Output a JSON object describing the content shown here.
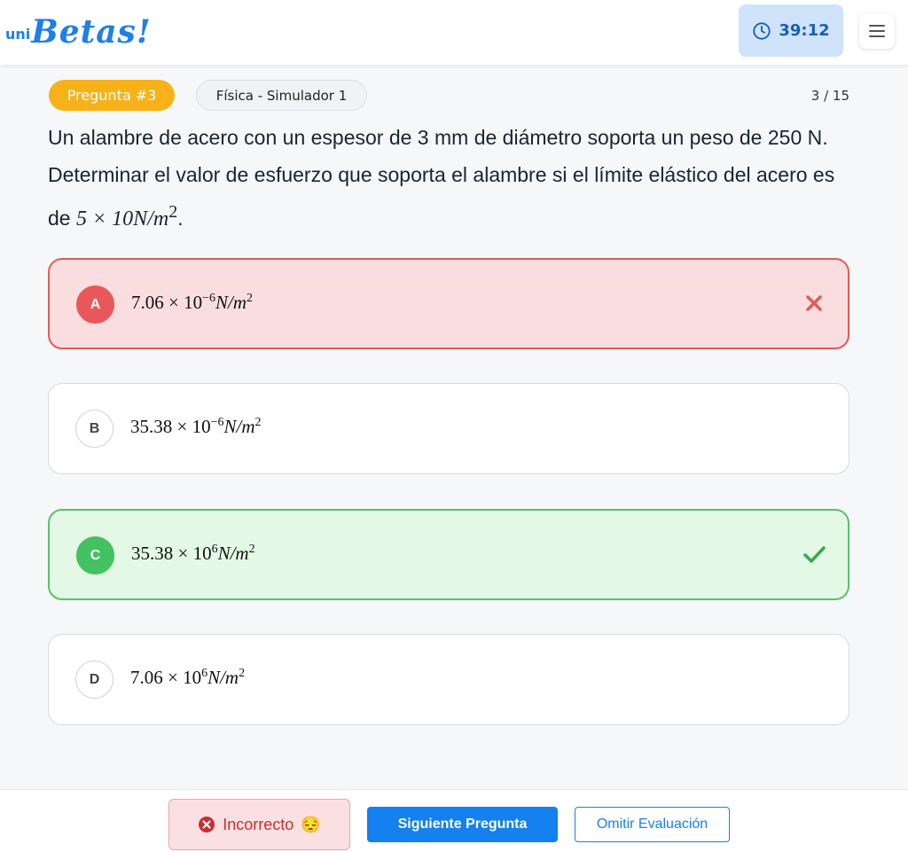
{
  "header": {
    "logo_prefix": "uni",
    "logo_main": "Betas!",
    "timer": "39:12",
    "colors": {
      "brand": "#1e7fe6",
      "timer_bg": "#cfe3fb"
    }
  },
  "question": {
    "badge": "Pregunta #3",
    "subject": "Física - Simulador 1",
    "counter": "3 / 15",
    "text_part1": "Un alambre de acero con un espesor de 3 mm de diámetro soporta un peso de 250 N. Determinar el valor de esfuerzo que soporta el alambre si el límite elástico del acero es de ",
    "formula_main": "5 × 10N/m",
    "formula_exp": "2",
    "text_end": "."
  },
  "options": [
    {
      "letter": "A",
      "mantissa": "7.06 × 10",
      "exp": "−6",
      "unit": "N/m",
      "unit_exp": "2",
      "state": "incorrect",
      "mark_icon": "x-icon"
    },
    {
      "letter": "B",
      "mantissa": "35.38 × 10",
      "exp": "−6",
      "unit": "N/m",
      "unit_exp": "2",
      "state": "neutral"
    },
    {
      "letter": "C",
      "mantissa": "35.38 × 10",
      "exp": "6",
      "unit": "N/m",
      "unit_exp": "2",
      "state": "correct",
      "mark_icon": "check-icon"
    },
    {
      "letter": "D",
      "mantissa": "7.06 × 10",
      "exp": "6",
      "unit": "N/m",
      "unit_exp": "2",
      "state": "neutral"
    }
  ],
  "footer": {
    "status_label": "Incorrecto",
    "status_emoji": "😔",
    "next_label": "Siguiente Pregunta",
    "skip_label": "Omitir Evaluación",
    "colors": {
      "primary": "#1580ef",
      "error": "#c72f35",
      "success": "#44c161"
    }
  }
}
